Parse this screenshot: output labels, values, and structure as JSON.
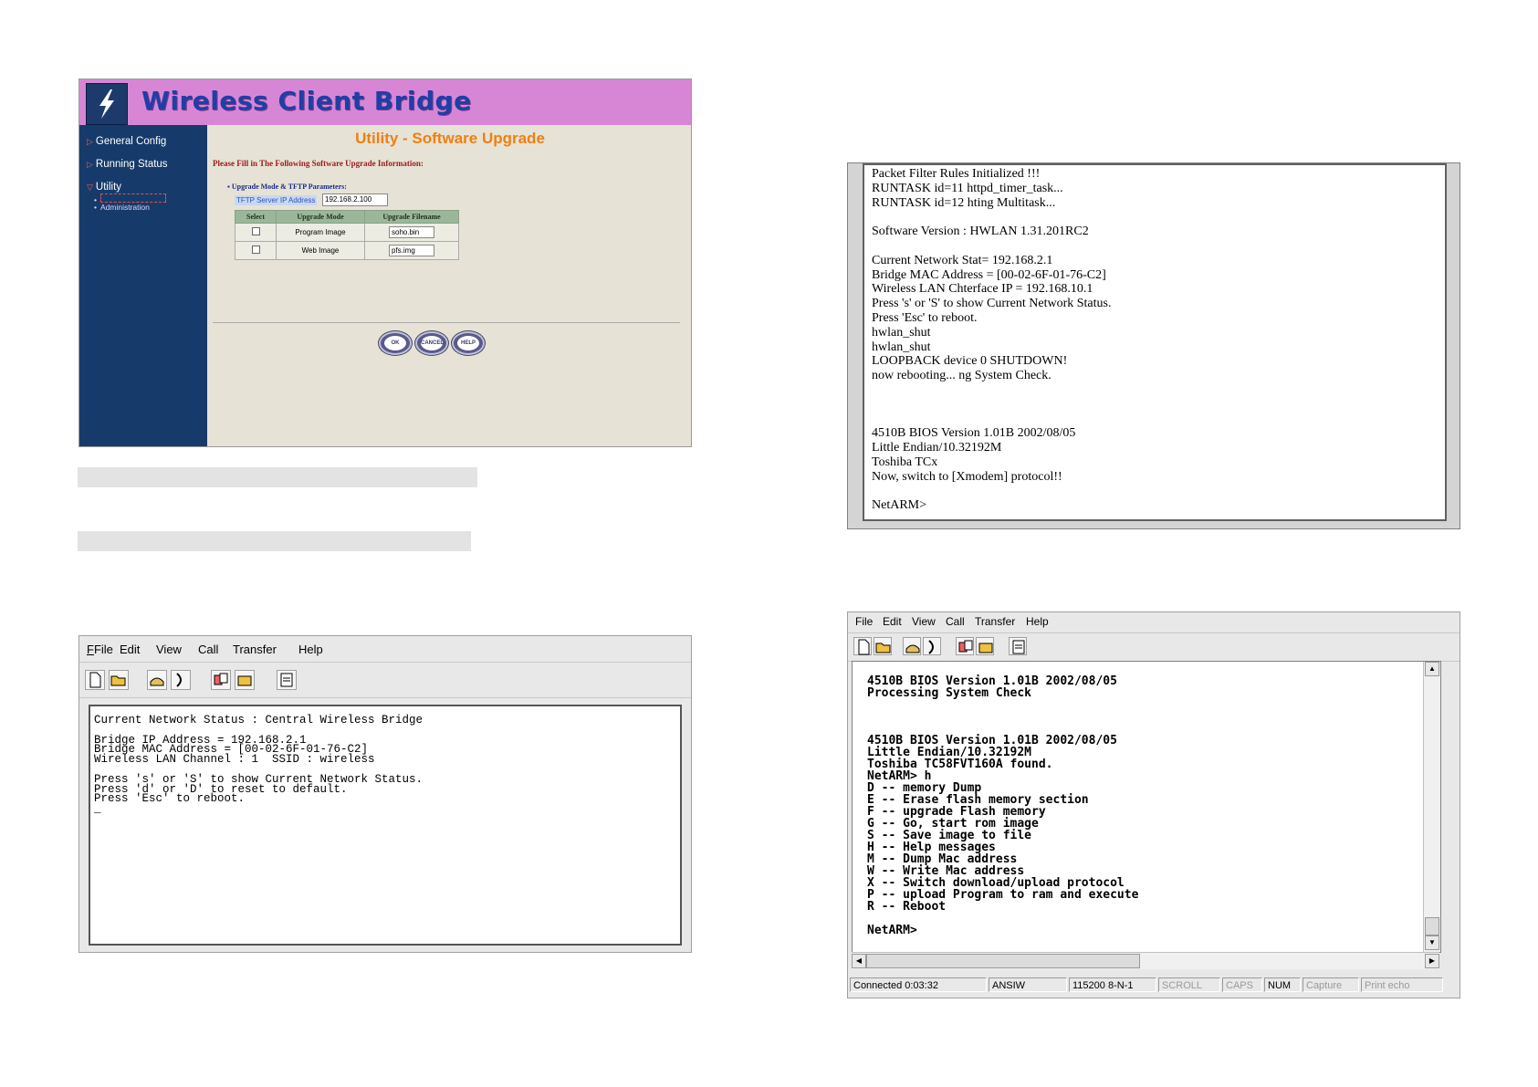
{
  "web_ui": {
    "header_title": "Wireless Client Bridge",
    "nav": [
      {
        "label": "General Config"
      },
      {
        "label": "Running Status"
      },
      {
        "label": "Utility"
      }
    ],
    "utility_sub": [
      "",
      "Administration"
    ],
    "page_title": "Utility - Software Upgrade",
    "fill_note": "Please Fill in The Following Software Upgrade Information:",
    "params_heading": "Upgrade Mode & TFTP Parameters:",
    "tftp_label": "TFTP Server IP Address",
    "tftp_value": "192.168.2.100",
    "table_headers": [
      "Select",
      "Upgrade Mode",
      "Upgrade Filename"
    ],
    "rows": [
      {
        "mode": "Program Image",
        "filename": "soho.bin"
      },
      {
        "mode": "Web Image",
        "filename": "pfs.img"
      }
    ],
    "buttons": {
      "ok": "OK",
      "cancel": "CANCEL",
      "help": "HELP"
    },
    "colors": {
      "header": "#d786d6",
      "sidebar": "#163b6a",
      "title": "#f07f10"
    }
  },
  "menu": {
    "file": "File",
    "edit": "Edit",
    "view": "View",
    "call": "Call",
    "transfer": "Transfer",
    "help": "Help"
  },
  "terminal_status": {
    "lines": [
      "Current Network Status : Central Wireless Bridge",
      "",
      "Bridge IP Address = 192.168.2.1",
      "Bridge MAC Address = [00-02-6F-01-76-C2]",
      "Wireless LAN Channel : 1  SSID : wireless",
      "",
      "Press 's' or 'S' to show Current Network Status.",
      "Press 'd' or 'D' to reset to default.",
      "Press 'Esc' to reboot.",
      "_"
    ]
  },
  "terminal_reboot": {
    "lines": [
      "Packet Filter Rules Initialized !!!",
      "RUNTASK id=11 httpd_timer_task...",
      "RUNTASK id=12 hting Multitask...",
      "",
      "Software Version : HWLAN 1.31.201RC2",
      "",
      "Current Network Stat= 192.168.2.1",
      "Bridge MAC Address = [00-02-6F-01-76-C2]",
      "Wireless LAN Chterface IP = 192.168.10.1",
      "Press 's' or 'S' to show Current Network Status.",
      "Press 'Esc' to reboot.",
      "hwlan_shut",
      "hwlan_shut",
      "LOOPBACK device 0 SHUTDOWN!",
      "now rebooting... ng System Check.",
      "",
      "",
      "",
      "4510B BIOS Version 1.01B 2002/08/05",
      "Little Endian/10.32192M",
      "Toshiba TCx",
      "Now, switch to [Xmodem] protocol!!",
      "",
      "NetARM>"
    ]
  },
  "terminal_bios": {
    "lines": [
      "",
      "4510B BIOS Version 1.01B 2002/08/05",
      "Processing System Check",
      "",
      "",
      "",
      "4510B BIOS Version 1.01B 2002/08/05",
      "Little Endian/10.32192M",
      "Toshiba TC58FVT160A found.",
      "NetARM> h",
      "D -- memory Dump",
      "E -- Erase flash memory section",
      "F -- upgrade Flash memory",
      "G -- Go, start rom image",
      "S -- Save image to file",
      "H -- Help messages",
      "M -- Dump Mac address",
      "W -- Write Mac address",
      "X -- Switch download/upload protocol",
      "P -- upload Program to ram and execute",
      "R -- Reboot",
      "",
      "NetARM>"
    ],
    "status": [
      "Connected 0:03:32",
      "ANSIW",
      "115200 8-N-1",
      "SCROLL",
      "CAPS",
      "NUM",
      "Capture",
      "Print echo"
    ]
  }
}
